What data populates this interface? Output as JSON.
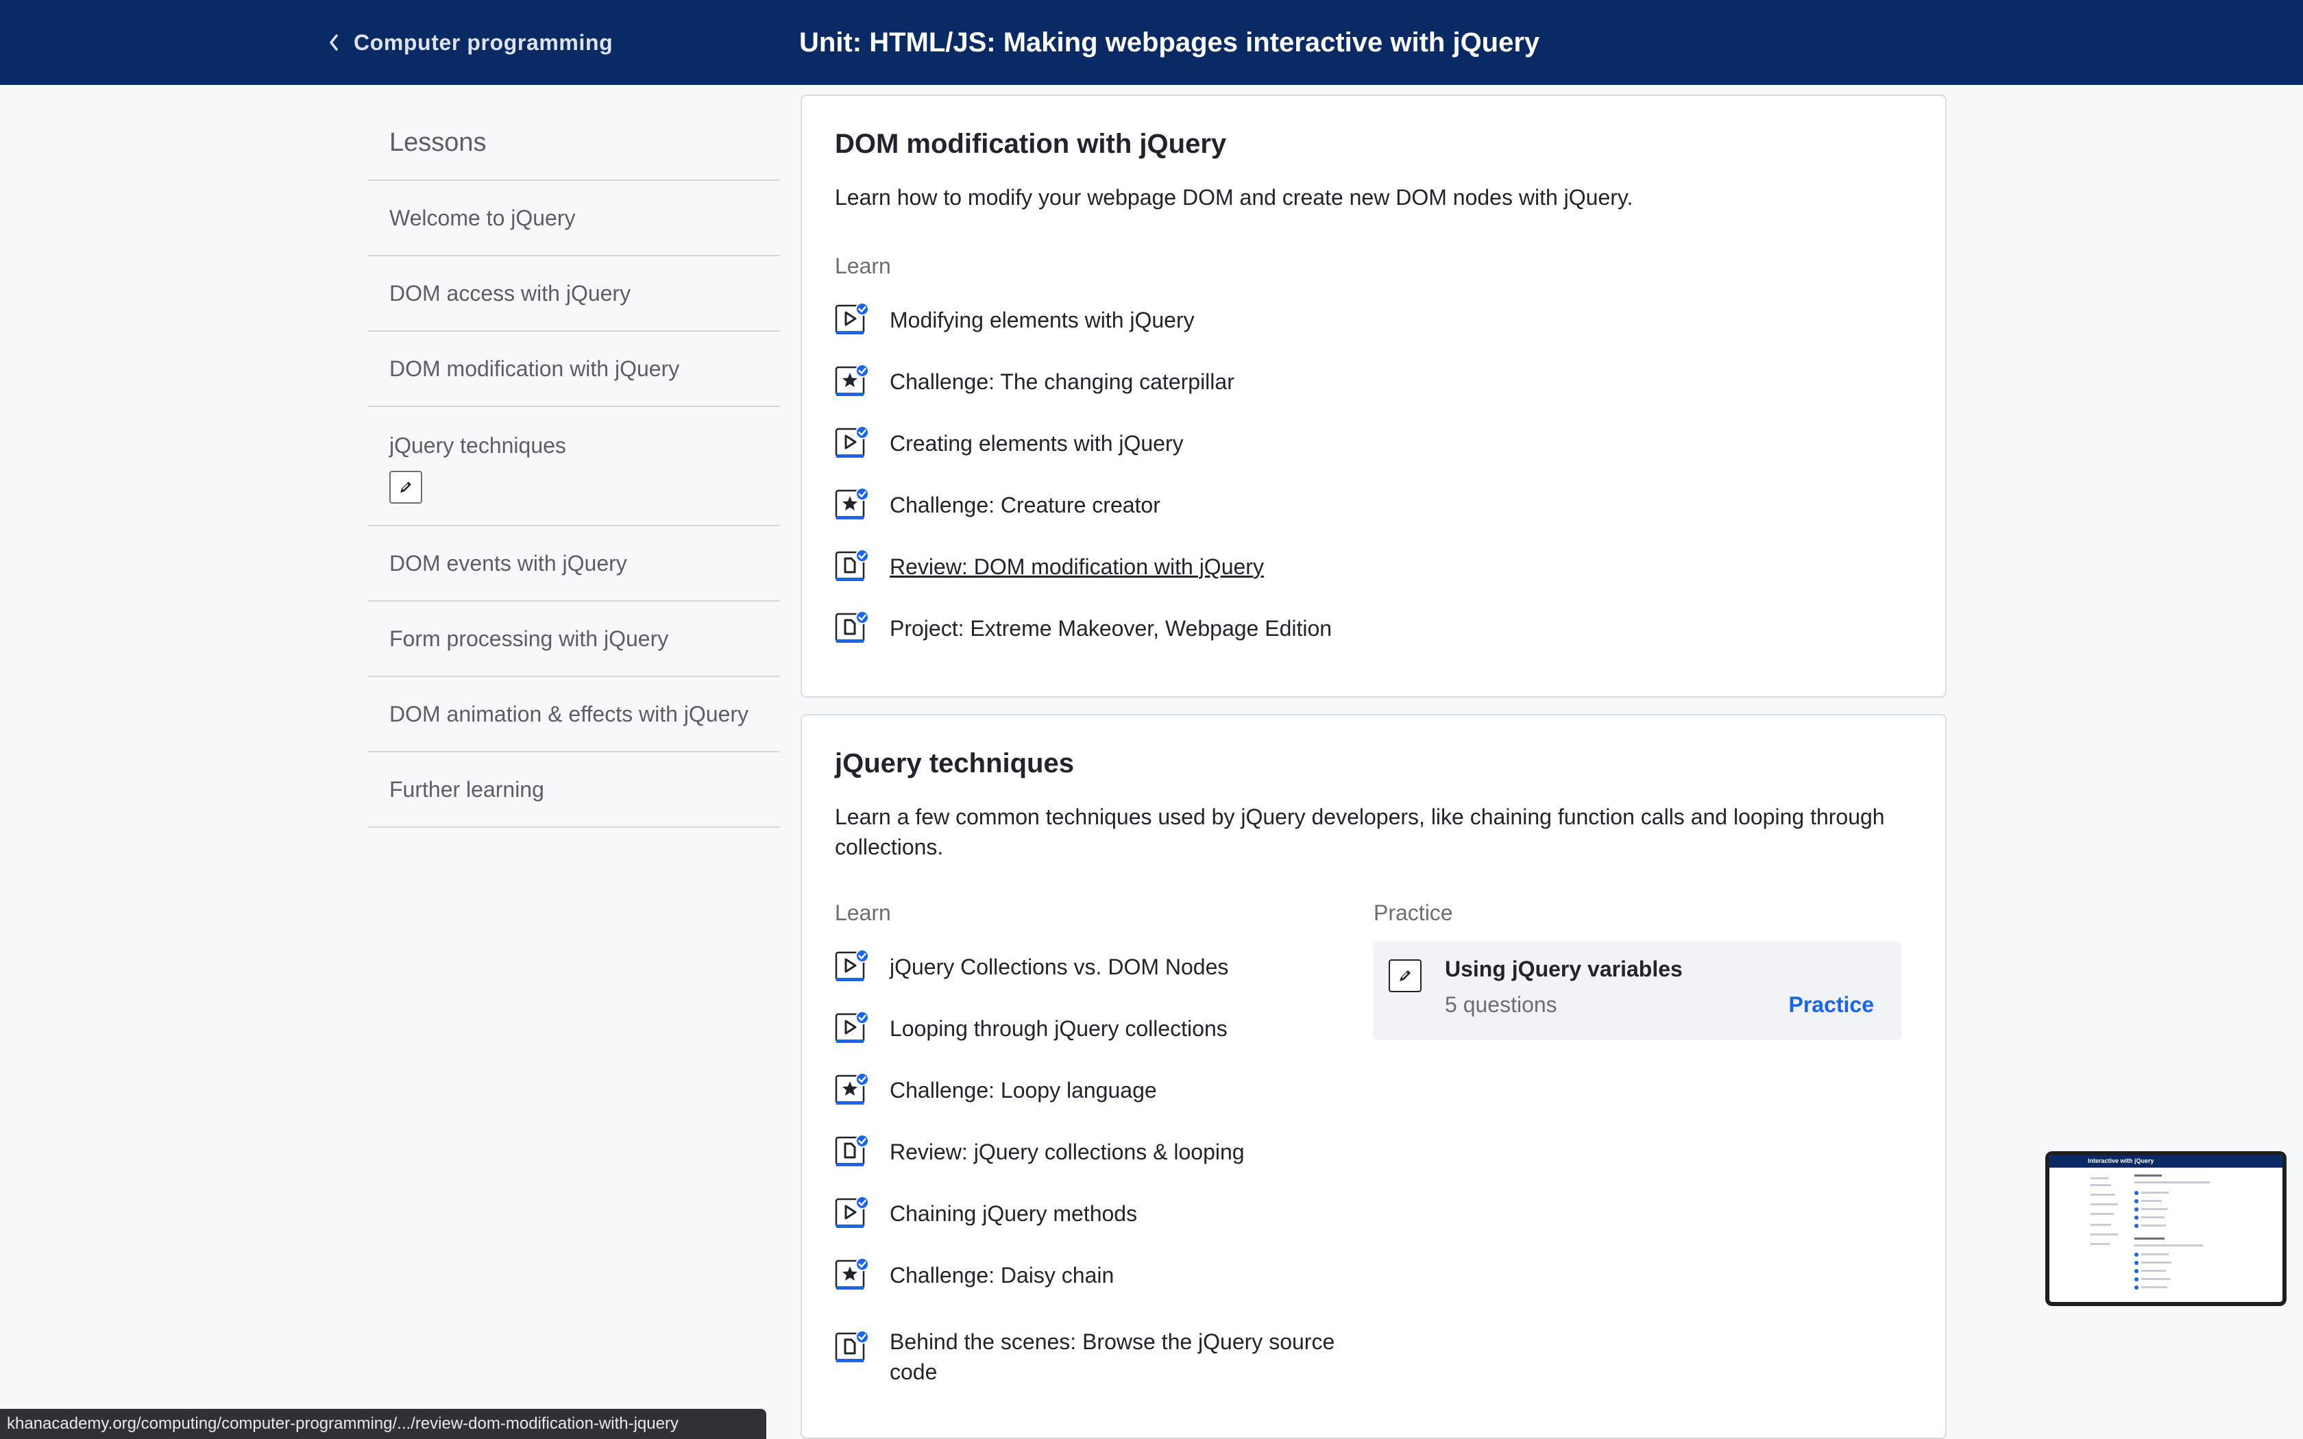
{
  "header": {
    "back_label": "Computer programming",
    "unit_title": "Unit: HTML/JS: Making webpages interactive with jQuery"
  },
  "sidebar": {
    "title": "Lessons",
    "items": [
      {
        "label": "Welcome to jQuery"
      },
      {
        "label": "DOM access with jQuery"
      },
      {
        "label": "DOM modification with jQuery"
      },
      {
        "label": "jQuery techniques",
        "badge": "pencil-icon"
      },
      {
        "label": "DOM events with jQuery"
      },
      {
        "label": "Form processing with jQuery"
      },
      {
        "label": "DOM animation & effects with jQuery"
      },
      {
        "label": "Further learning"
      }
    ]
  },
  "lessons": [
    {
      "title": "DOM modification with jQuery",
      "description": "Learn how to modify your webpage DOM and create new DOM nodes with jQuery.",
      "learn_label": "Learn",
      "items": [
        {
          "type": "video",
          "label": "Modifying elements with jQuery",
          "completed": true
        },
        {
          "type": "challenge",
          "label": "Challenge: The changing caterpillar",
          "completed": true
        },
        {
          "type": "video",
          "label": "Creating elements with jQuery",
          "completed": true
        },
        {
          "type": "challenge",
          "label": "Challenge: Creature creator",
          "completed": true
        },
        {
          "type": "article",
          "label": "Review: DOM modification with jQuery",
          "completed": true,
          "hovered_link": true
        },
        {
          "type": "article",
          "label": "Project: Extreme Makeover, Webpage Edition",
          "completed": true
        }
      ]
    },
    {
      "title": "jQuery techniques",
      "description": "Learn a few common techniques used by jQuery developers, like chaining function calls and looping through collections.",
      "learn_label": "Learn",
      "practice_label": "Practice",
      "items": [
        {
          "type": "video",
          "label": "jQuery Collections vs. DOM Nodes",
          "completed": true
        },
        {
          "type": "video",
          "label": "Looping through jQuery collections",
          "completed": true
        },
        {
          "type": "challenge",
          "label": "Challenge: Loopy language",
          "completed": true
        },
        {
          "type": "article",
          "label": "Review: jQuery collections & looping",
          "completed": true
        },
        {
          "type": "video",
          "label": "Chaining jQuery methods",
          "completed": true
        },
        {
          "type": "challenge",
          "label": "Challenge: Daisy chain",
          "completed": true
        },
        {
          "type": "article",
          "label": "Behind the scenes: Browse the jQuery source code",
          "completed": true
        }
      ],
      "practice": {
        "name": "Using jQuery variables",
        "count": "5 questions",
        "button": "Practice"
      }
    }
  ],
  "status_bar": {
    "url": "khanacademy.org/computing/computer-programming/.../review-dom-modification-with-jquery"
  },
  "minimap": {
    "title": "Interactive with jQuery"
  },
  "colors": {
    "header_bg": "#0a2a66",
    "accent": "#1865f2",
    "page_bg": "#f7f8fa"
  }
}
